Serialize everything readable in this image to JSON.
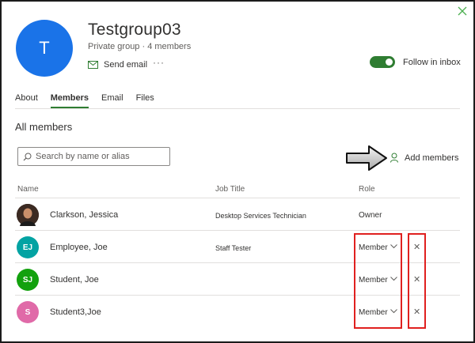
{
  "header": {
    "avatar_initial": "T",
    "title": "Testgroup03",
    "meta": "Private group · 4 members",
    "send_email": "Send email",
    "more": "···",
    "follow_label": "Follow in inbox",
    "follow_on": true
  },
  "tabs": [
    {
      "label": "About",
      "active": false
    },
    {
      "label": "Members",
      "active": true
    },
    {
      "label": "Email",
      "active": false
    },
    {
      "label": "Files",
      "active": false
    }
  ],
  "members": {
    "section_title": "All members",
    "search_placeholder": "Search by name or alias",
    "add_button": "Add members",
    "columns": {
      "name": "Name",
      "job": "Job Title",
      "role": "Role"
    },
    "rows": [
      {
        "initials": "",
        "name": "Clarkson, Jessica",
        "job": "Desktop Services Technician",
        "role": "Owner",
        "avatar_color": "#3b2a22"
      },
      {
        "initials": "EJ",
        "name": "Employee, Joe",
        "job": "Staff Tester",
        "role": "Member",
        "avatar_color": "#03a3a3"
      },
      {
        "initials": "SJ",
        "name": "Student, Joe",
        "job": "",
        "role": "Member",
        "avatar_color": "#13a10e"
      },
      {
        "initials": "S",
        "name": "Student3,Joe",
        "job": "",
        "role": "Member",
        "avatar_color": "#e06aa8"
      }
    ]
  },
  "colors": {
    "accent": "#2f7d32",
    "highlight": "#e0201f",
    "avatar": "#1a73e8"
  }
}
